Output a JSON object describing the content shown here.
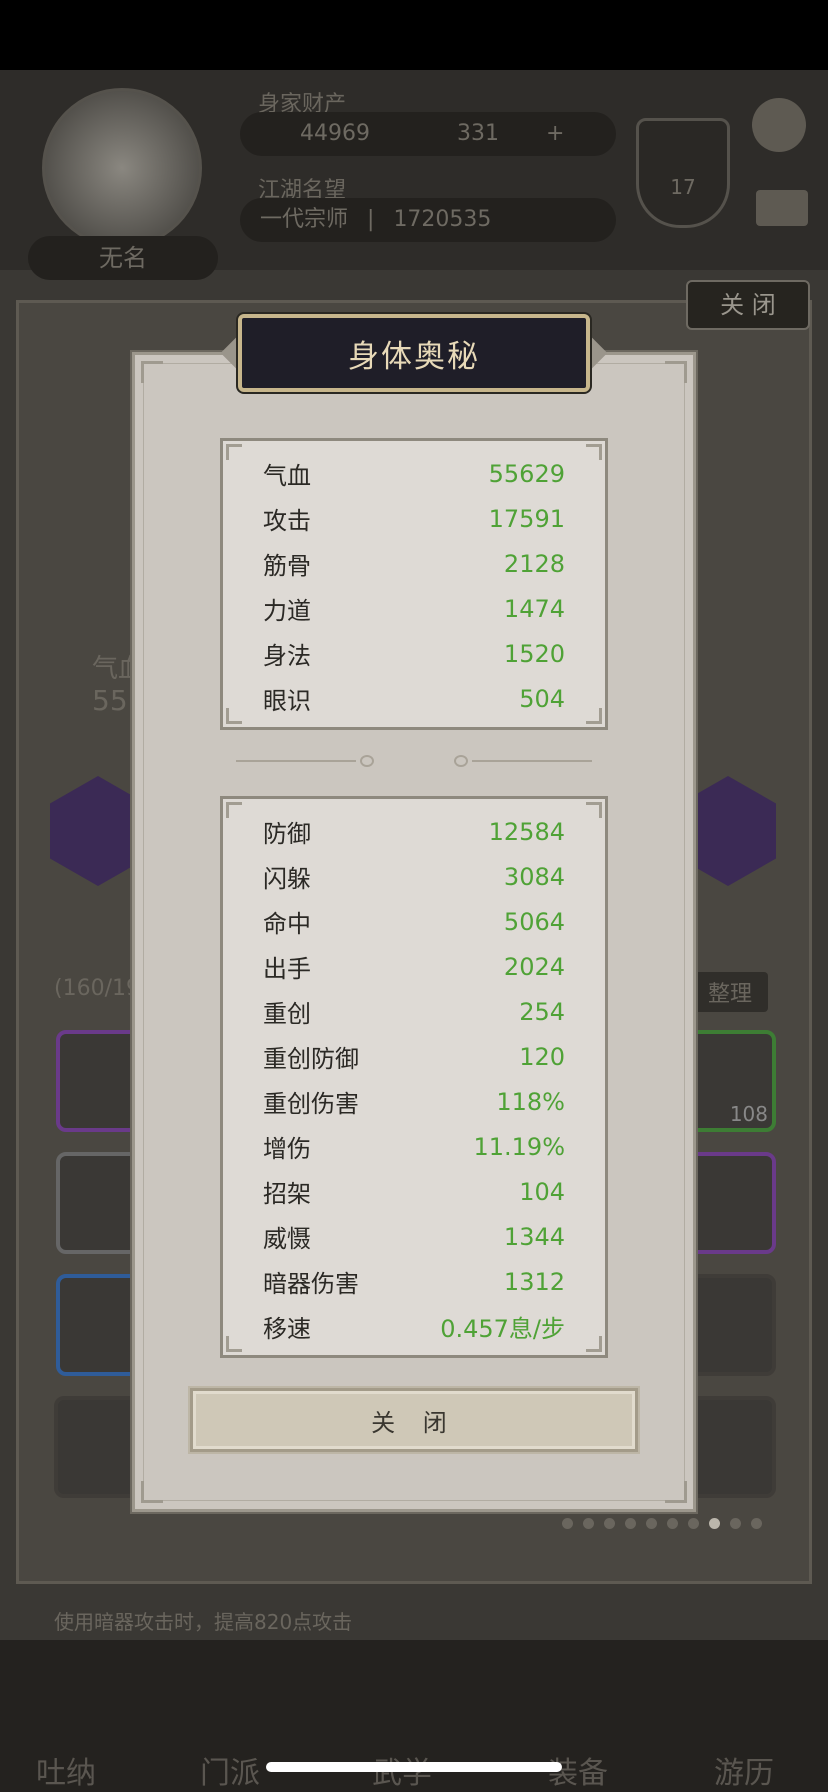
{
  "background": {
    "header": {
      "wealth_label": "身家财产",
      "gold": "44969",
      "jade": "331",
      "fame_label": "江湖名望",
      "rank_title": "一代宗师",
      "fame_value": "1720535",
      "player_name": "无名",
      "level": "17"
    },
    "close_top_label": "关 闭",
    "inventory_count": "(160/19",
    "sort_label": "整理",
    "item_count": "108",
    "stat_preview_label": "气血",
    "stat_preview_value": "55",
    "tip_text": "使用暗器攻击时，提高820点攻击",
    "nav": [
      "吐纳",
      "门派",
      "武学",
      "装备",
      "游历"
    ],
    "page_dots": 10,
    "active_dot": 7
  },
  "modal": {
    "title": "身体奥秘",
    "primary_stats": [
      {
        "label": "气血",
        "value": "55629"
      },
      {
        "label": "攻击",
        "value": "17591"
      },
      {
        "label": "筋骨",
        "value": "2128"
      },
      {
        "label": "力道",
        "value": "1474"
      },
      {
        "label": "身法",
        "value": "1520"
      },
      {
        "label": "眼识",
        "value": "504"
      }
    ],
    "secondary_stats": [
      {
        "label": "防御",
        "value": "12584"
      },
      {
        "label": "闪躲",
        "value": "3084"
      },
      {
        "label": "命中",
        "value": "5064"
      },
      {
        "label": "出手",
        "value": "2024"
      },
      {
        "label": "重创",
        "value": "254"
      },
      {
        "label": "重创防御",
        "value": "120"
      },
      {
        "label": "重创伤害",
        "value": "118%"
      },
      {
        "label": "增伤",
        "value": "11.19%"
      },
      {
        "label": "招架",
        "value": "104"
      },
      {
        "label": "威慑",
        "value": "1344"
      },
      {
        "label": "暗器伤害",
        "value": "1312"
      },
      {
        "label": "移速",
        "value": "0.457息/步"
      }
    ],
    "close_label": "关 闭"
  },
  "colors": {
    "stat_value": "#4fa236",
    "title_text": "#e7d9b8",
    "modal_bg": "#cbc6bf"
  }
}
